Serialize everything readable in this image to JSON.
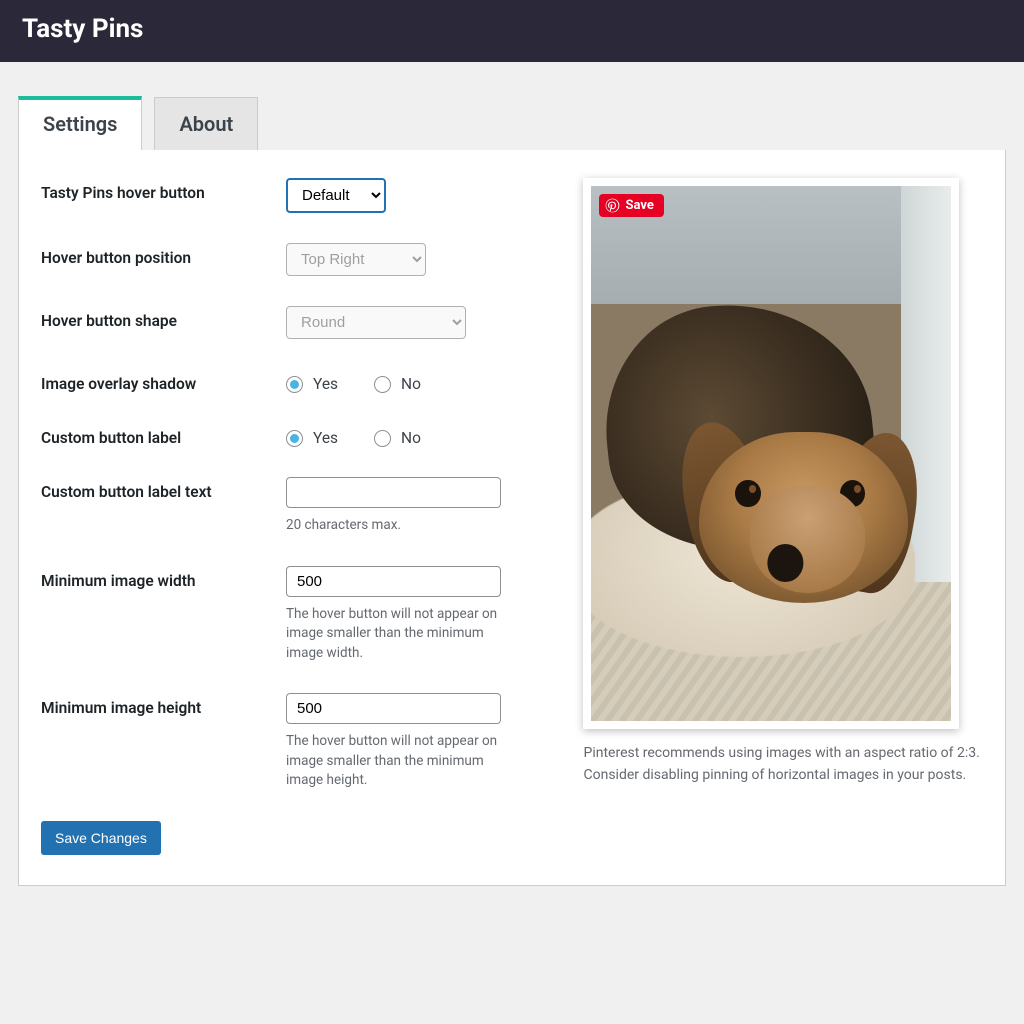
{
  "header": {
    "title": "Tasty Pins"
  },
  "tabs": {
    "settings": "Settings",
    "about": "About"
  },
  "fields": {
    "hover_button": {
      "label": "Tasty Pins hover button",
      "value": "Default"
    },
    "hover_position": {
      "label": "Hover button position",
      "value": "Top Right"
    },
    "hover_shape": {
      "label": "Hover button shape",
      "value": "Round"
    },
    "overlay_shadow": {
      "label": "Image overlay shadow",
      "yes": "Yes",
      "no": "No"
    },
    "custom_label": {
      "label": "Custom button label",
      "yes": "Yes",
      "no": "No"
    },
    "custom_label_text": {
      "label": "Custom button label text",
      "value": "",
      "helper": "20 characters max."
    },
    "min_width": {
      "label": "Minimum image width",
      "value": "500",
      "helper": "The hover button will not appear on image smaller than the minimum image width."
    },
    "min_height": {
      "label": "Minimum image height",
      "value": "500",
      "helper": "The hover button will not appear on image smaller than the minimum image height."
    }
  },
  "save_button": "Save Changes",
  "preview": {
    "pin_label": "Save",
    "note": "Pinterest recommends using images with an aspect ratio of 2:3. Consider disabling pinning of horizontal images in your posts."
  }
}
